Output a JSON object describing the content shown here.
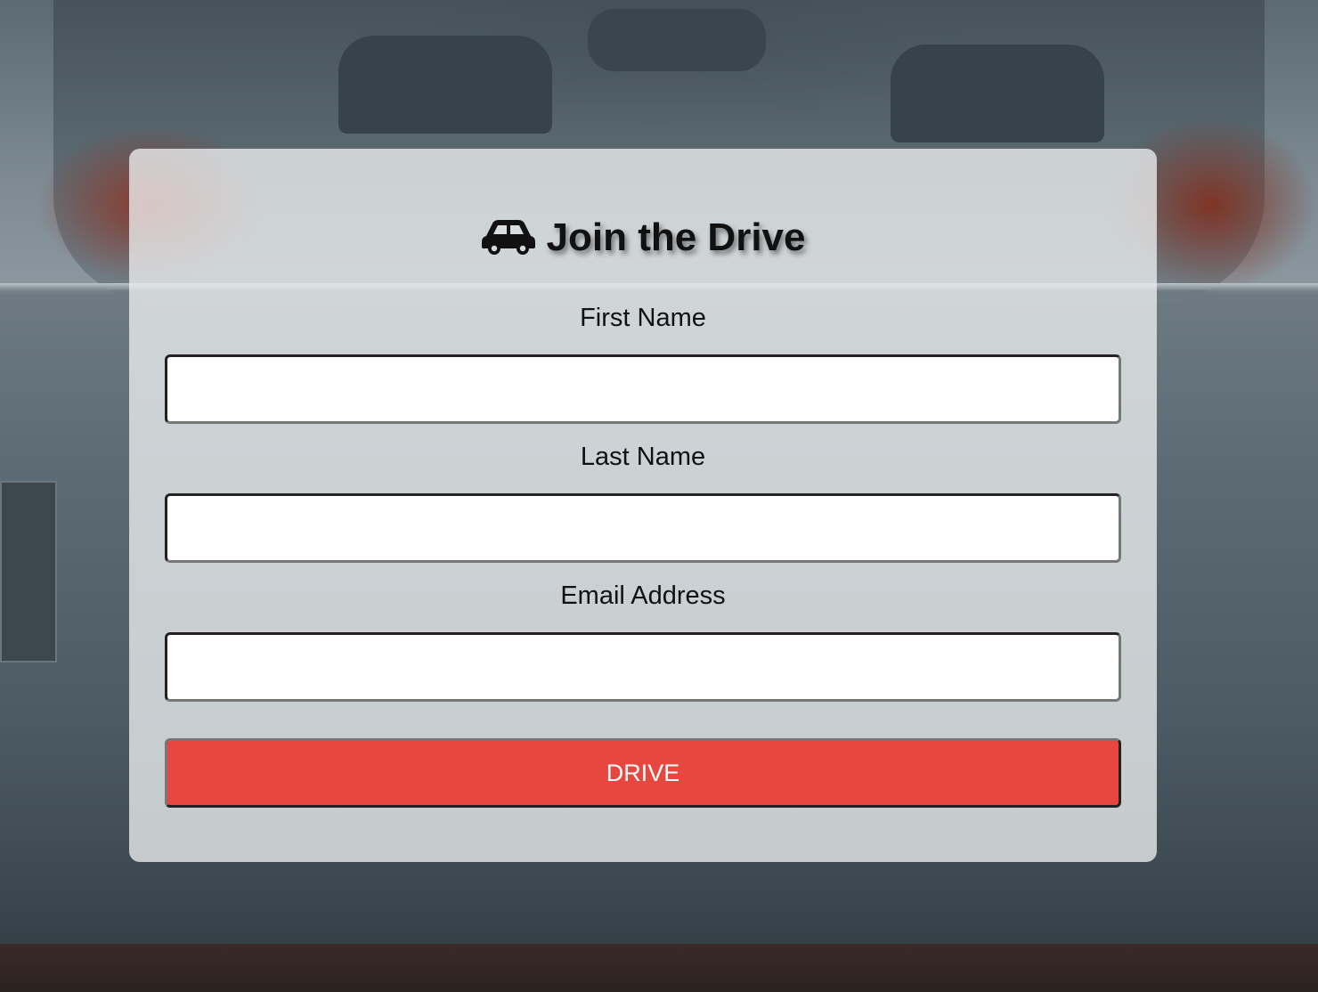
{
  "form": {
    "title": "Join the Drive",
    "title_icon": "car-icon",
    "fields": [
      {
        "label": "First Name",
        "value": "",
        "placeholder": ""
      },
      {
        "label": "Last Name",
        "value": "",
        "placeholder": ""
      },
      {
        "label": "Email Address",
        "value": "",
        "placeholder": ""
      }
    ],
    "submit_label": "DRIVE"
  },
  "colors": {
    "accent": "#e7473f",
    "card": "#eceef0"
  }
}
